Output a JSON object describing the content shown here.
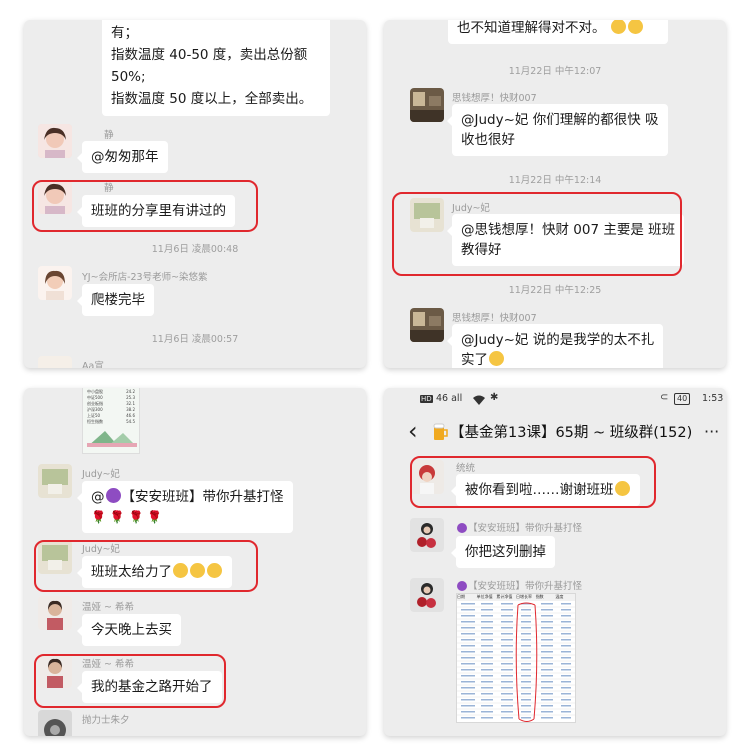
{
  "panel1": {
    "top_message_lines": [
      "有；",
      "指数温度 40-50 度，卖出总份额",
      "50%;",
      "指数温度 50 度以上，全部卖出。"
    ],
    "msg1": {
      "sender": "静",
      "text": "@匆匆那年"
    },
    "msg2": {
      "sender": "静",
      "text": "班班的分享里有讲过的"
    },
    "time1": "11月6日 凌晨00:48",
    "msg3": {
      "sender": "YJ~会所店-23号老师~染悠紫",
      "text": "爬楼完毕"
    },
    "time2": "11月6日 凌晨00:57",
    "msg4_sender": "Aa宣"
  },
  "panel2": {
    "top_line": "也不知道理解得对不对。",
    "time1": "11月22日 中午12:07",
    "msg1": {
      "sender": "思钱想厚！快财007",
      "lines": [
        "@Judy~妃  你们理解的都很快  吸",
        "收也很好"
      ]
    },
    "time2": "11月22日 中午12:14",
    "msg2": {
      "sender": "Judy~妃",
      "lines": [
        "@思钱想厚！快财 007 主要是  班班",
        "教得好"
      ]
    },
    "time3": "11月22日 中午12:25",
    "msg3": {
      "sender": "思钱想厚！快财007",
      "lines": [
        "@Judy~妃    说的是我学的太不扎",
        "实了"
      ]
    }
  },
  "panel3": {
    "image_rows": [
      {
        "label": "中小盘股",
        "value": "24.2"
      },
      {
        "label": "中证500",
        "value": "25.3"
      },
      {
        "label": "创业板指",
        "value": "32.1"
      },
      {
        "label": "沪深300",
        "value": "38.2"
      },
      {
        "label": "上证50",
        "value": "46.6"
      },
      {
        "label": "恒生指数",
        "value": "54.5"
      }
    ],
    "msg1": {
      "sender": "Judy~妃",
      "text": "@",
      "mention": "【安安班班】带你升基打怪",
      "roses": "🌹 🌹 🌹 🌹"
    },
    "msg2": {
      "sender": "Judy~妃",
      "text": "班班太给力了"
    },
    "msg3": {
      "sender": "温娅 ~ 希希",
      "text": "今天晚上去买"
    },
    "msg4": {
      "sender": "温娅 ~ 希希",
      "text": "我的基金之路开始了"
    },
    "msg5_sender": "抛力士朱夕"
  },
  "panel4": {
    "status_left": "46 all",
    "status_right": "1:53",
    "battery": "40",
    "chat_title": "【基金第13课】65期 ~ 班级群(152)",
    "more": "···",
    "back": "‹",
    "msg1": {
      "sender": "统统",
      "text": "被你看到啦……谢谢班班"
    },
    "msg2": {
      "sender": "【安安班班】带你升基打怪",
      "text": "你把这列删掉"
    },
    "msg3": {
      "sender": "【安安班班】带你升基打怪"
    },
    "sheet_header": [
      "日期",
      "单位净值",
      "累计净值",
      "日增长率",
      "指数",
      "温度"
    ]
  },
  "colors": {
    "highlight": "#e0282e",
    "chat_bg": "#ededed",
    "bubble": "#ffffff"
  }
}
